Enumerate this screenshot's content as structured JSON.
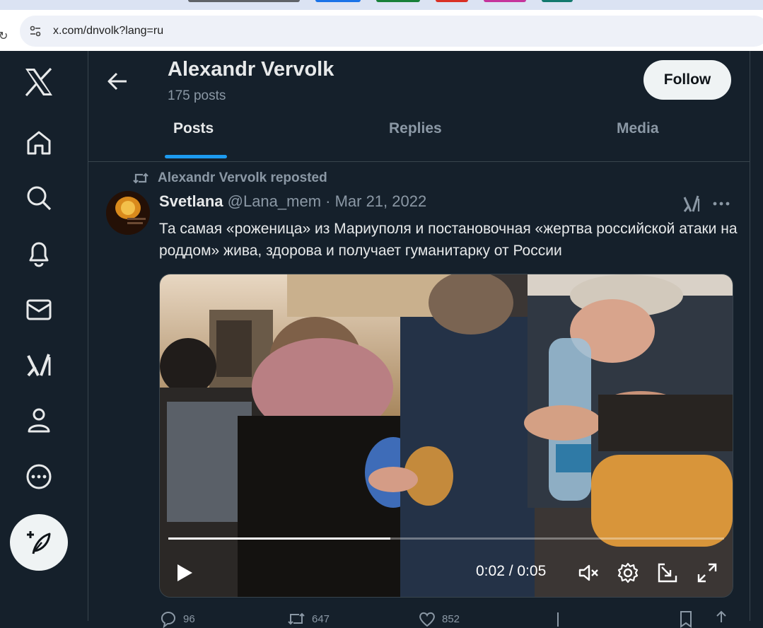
{
  "browser": {
    "url": "x.com/dnvolk?lang=ru"
  },
  "nav": {
    "items": [
      "x-logo",
      "home",
      "explore",
      "notifications",
      "messages",
      "grok",
      "profile",
      "more"
    ],
    "post_button_icon": "feather-plus-icon"
  },
  "profile": {
    "name": "Alexandr Vervolk",
    "post_count": "175 posts",
    "follow_label": "Follow",
    "tabs": [
      {
        "label": "Posts",
        "active": true
      },
      {
        "label": "Replies",
        "active": false
      },
      {
        "label": "Media",
        "active": false
      }
    ]
  },
  "tweet": {
    "repost_label": "Alexandr Vervolk reposted",
    "author": "Svetlana",
    "handle_date": "@Lana_mem · Mar 21, 2022",
    "text": "Та самая «роженица» из Мариуполя и постановочная «жертва российской атаки на роддом» жива, здорова и получает гуманитарку от России",
    "video": {
      "time": "0:02 / 0:05",
      "progress_fraction": 0.4
    },
    "counts": {
      "replies": "96",
      "reposts": "647",
      "likes": "852"
    }
  },
  "colors": {
    "background": "#15202b",
    "accent": "#1d9bf0",
    "text": "#e7e9ea",
    "secondary": "#8b98a5",
    "border": "#38444d"
  }
}
